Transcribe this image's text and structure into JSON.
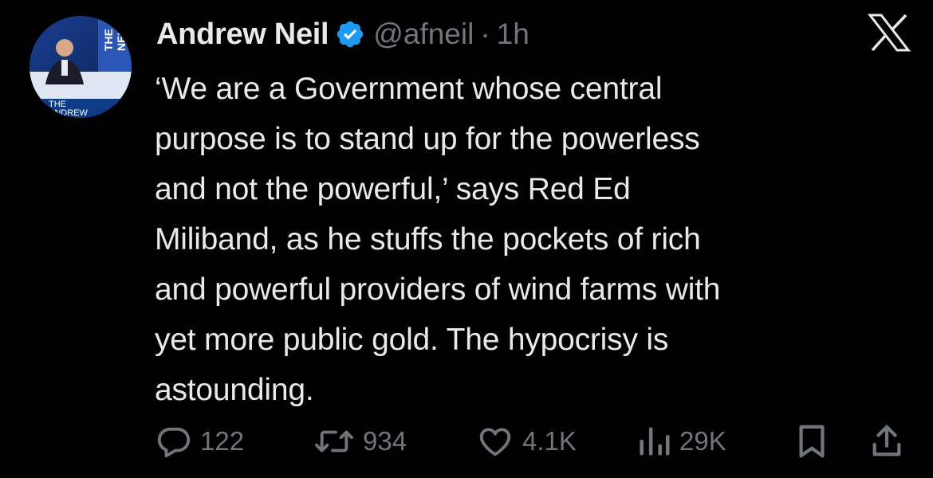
{
  "author": {
    "display_name": "Andrew Neil",
    "handle": "@afneil",
    "separator": "·",
    "time": "1h",
    "verified": true,
    "avatar_overlay_text": [
      "THE",
      "NEIL",
      "THE",
      "ANDREW"
    ]
  },
  "tweet": {
    "lines": [
      "‘We are a Government whose central",
      "purpose is to stand up for the powerless",
      "and not the powerful,’ says Red Ed",
      "Miliband, as he stuffs the pockets of rich",
      "and powerful providers of wind farms with",
      "yet more public gold. The hypocrisy is",
      "astounding."
    ]
  },
  "actions": {
    "replies": "122",
    "reposts": "934",
    "likes": "4.1K",
    "views": "29K"
  },
  "icons": {
    "brand": "x-logo-icon",
    "verified": "verified-badge-icon",
    "reply": "reply-icon",
    "repost": "repost-icon",
    "like": "heart-icon",
    "views": "views-icon",
    "bookmark": "bookmark-icon",
    "share": "share-icon"
  },
  "colors": {
    "background": "#000000",
    "text": "#e7e9ea",
    "muted": "#71767b",
    "verified_blue": "#1d9bf0"
  }
}
